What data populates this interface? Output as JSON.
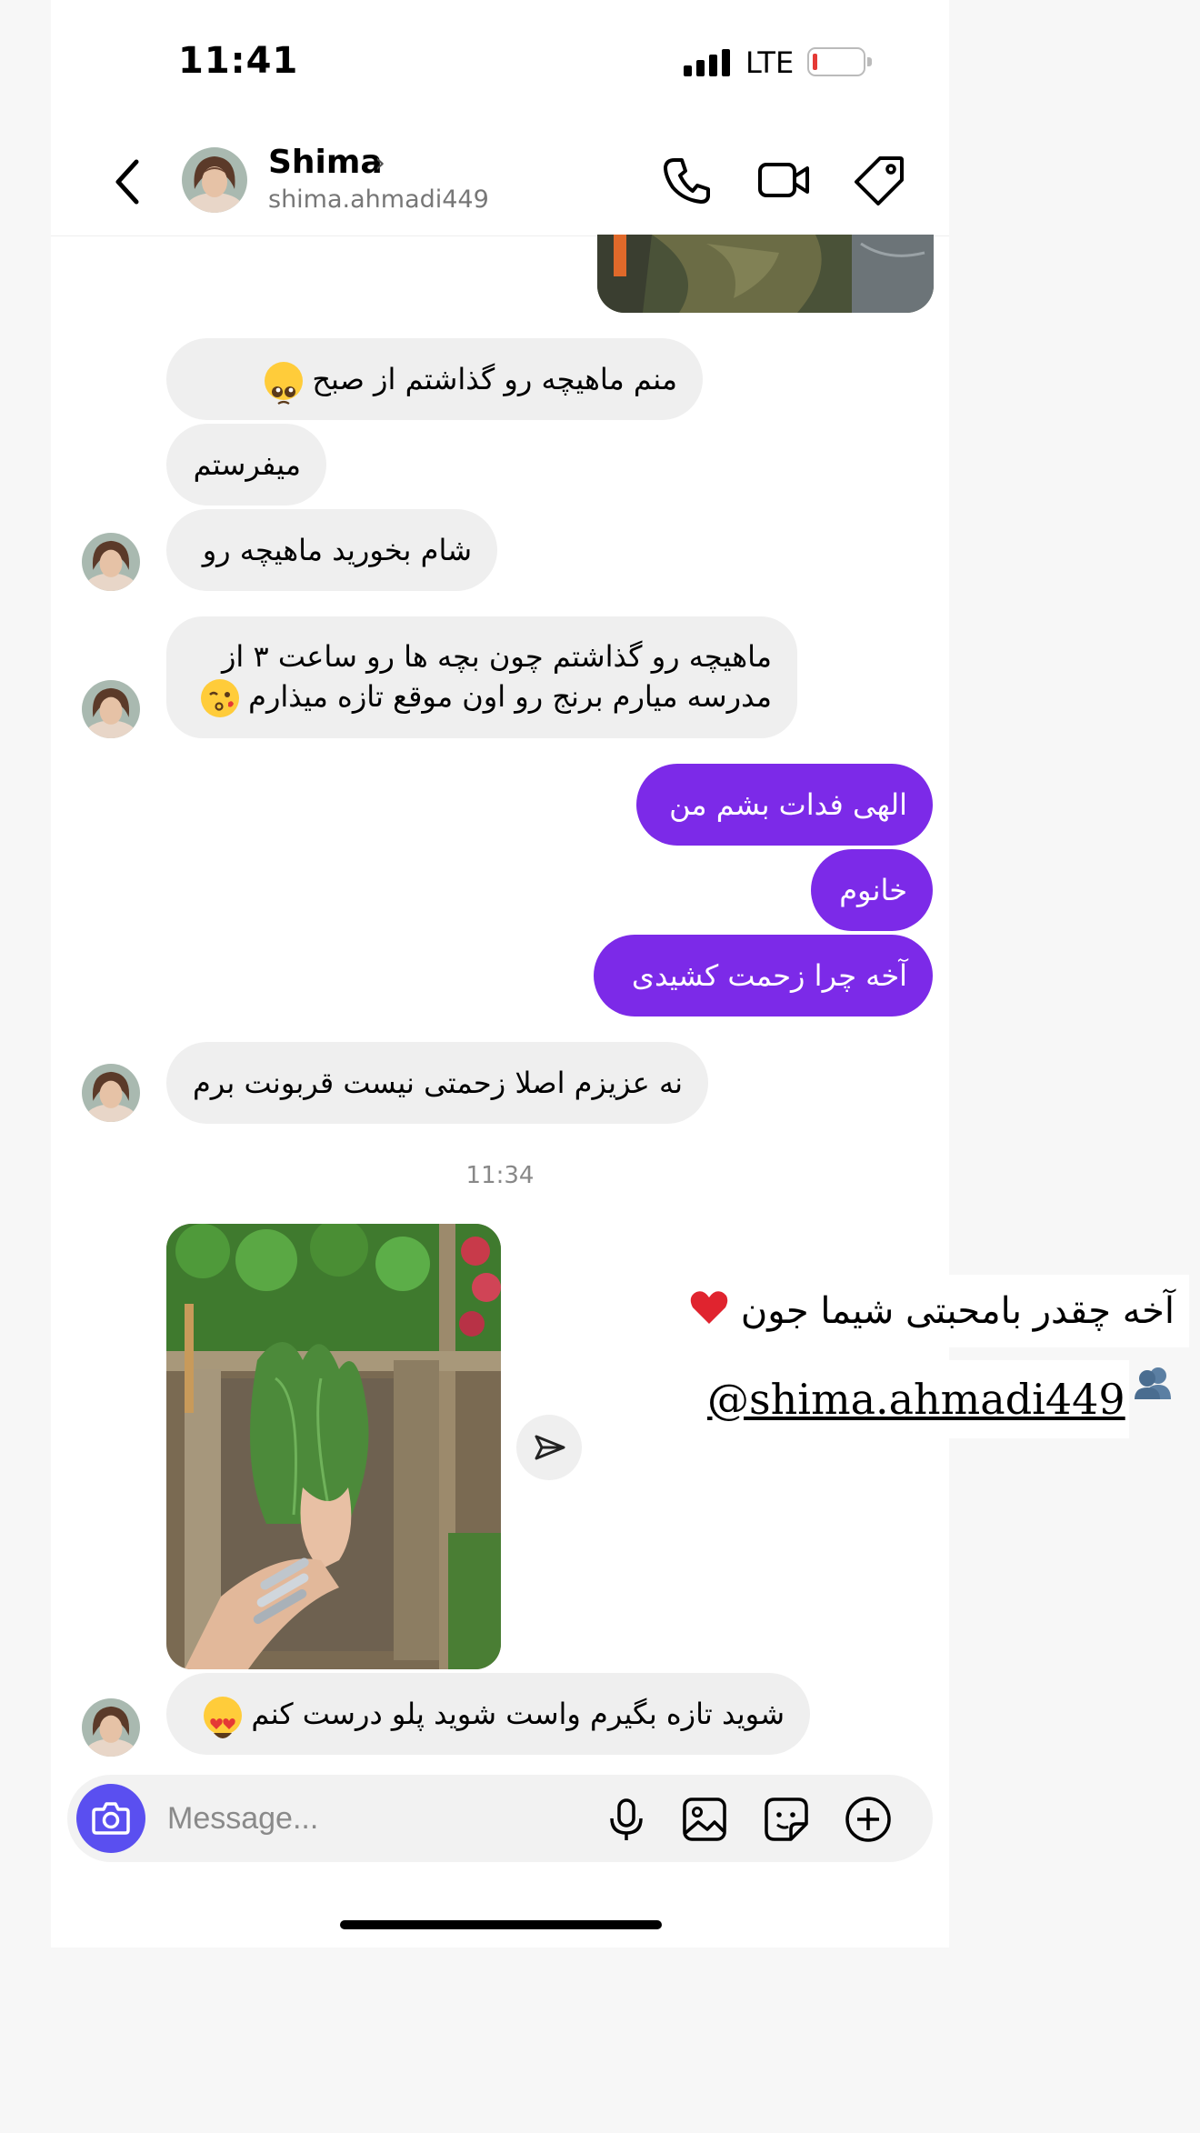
{
  "status_bar": {
    "time": "11:41",
    "network": "LTE"
  },
  "header": {
    "name": "Shima",
    "username": "shima.ahmadi449"
  },
  "messages": [
    {
      "text": "منم ماهیچه رو گذاشتم از صبح",
      "emoji": "pleading-face"
    },
    {
      "text": "میفرستم"
    },
    {
      "text": "شام بخورید ماهیچه رو"
    },
    {
      "line1": "ماهیچه رو گذاشتم چون بچه ها رو ساعت ۳ از",
      "line2": "مدرسه میارم برنج رو اون موقع تازه میذارم",
      "emoji": "kissing-face"
    },
    {
      "text": "الهی فدات بشم من"
    },
    {
      "text": "خانوم"
    },
    {
      "text": "آخه چرا زحمت کشیدی"
    },
    {
      "text": "نه عزیزم اصلا زحمتی نیست قربونت برم"
    },
    {
      "text": "شوید تازه بگیرم واست شوید پلو درست کنم",
      "emoji": "heart-eyes-face"
    }
  ],
  "time_separator": "11:34",
  "shared_post": {
    "caption": "آخه چقدر بامحبتی شیما جون",
    "caption_emojis": [
      "red-heart",
      "busts-in-silhouette"
    ],
    "mention": "@shima.ahmadi449"
  },
  "composer": {
    "placeholder": "Message..."
  },
  "colors": {
    "sent_bubble": "#7c2ae8",
    "received_bubble": "#efefef",
    "camera_button": "#5a4ff0"
  }
}
